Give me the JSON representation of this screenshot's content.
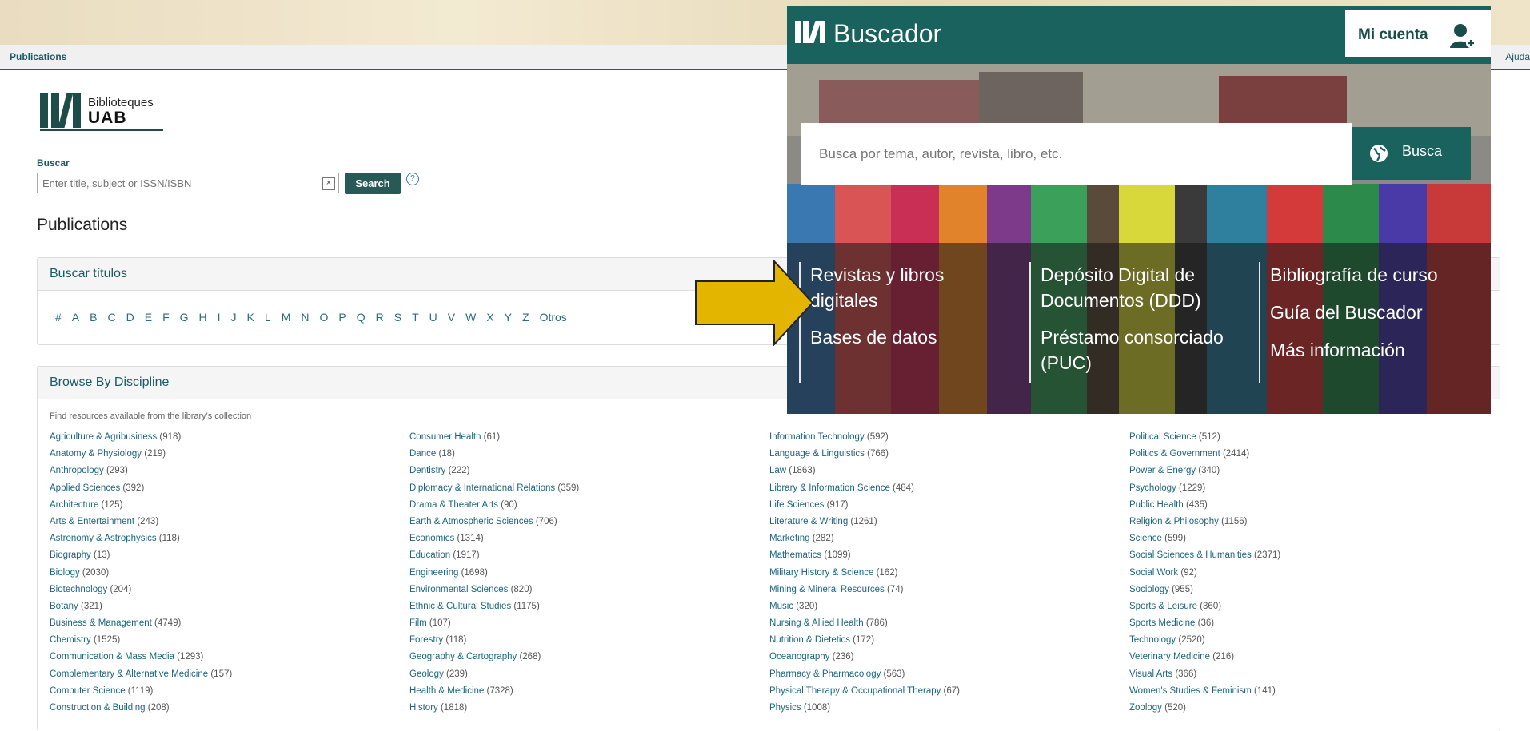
{
  "navbar": {
    "title": "Publications",
    "help": "Ajuda"
  },
  "logo": {
    "line1": "Biblioteques",
    "line2": "UAB"
  },
  "search": {
    "label": "Buscar",
    "placeholder": "Enter title, subject or ISSN/ISBN",
    "button": "Search",
    "help": "?"
  },
  "page_title": "Publications",
  "titles_panel": {
    "heading": "Buscar títulos",
    "letters": [
      "#",
      "A",
      "B",
      "C",
      "D",
      "E",
      "F",
      "G",
      "H",
      "I",
      "J",
      "K",
      "L",
      "M",
      "N",
      "O",
      "P",
      "Q",
      "R",
      "S",
      "T",
      "U",
      "V",
      "W",
      "X",
      "Y",
      "Z",
      "Otros"
    ]
  },
  "discipline_panel": {
    "heading": "Browse By Discipline",
    "intro": "Find resources available from the library's collection",
    "columns": [
      [
        {
          "name": "Agriculture & Agribusiness",
          "count": "(918)"
        },
        {
          "name": "Anatomy & Physiology",
          "count": "(219)"
        },
        {
          "name": "Anthropology",
          "count": "(293)"
        },
        {
          "name": "Applied Sciences",
          "count": "(392)"
        },
        {
          "name": "Architecture",
          "count": "(125)"
        },
        {
          "name": "Arts & Entertainment",
          "count": "(243)"
        },
        {
          "name": "Astronomy & Astrophysics",
          "count": "(118)"
        },
        {
          "name": "Biography",
          "count": "(13)"
        },
        {
          "name": "Biology",
          "count": "(2030)"
        },
        {
          "name": "Biotechnology",
          "count": "(204)"
        },
        {
          "name": "Botany",
          "count": "(321)"
        },
        {
          "name": "Business & Management",
          "count": "(4749)"
        },
        {
          "name": "Chemistry",
          "count": "(1525)"
        },
        {
          "name": "Communication & Mass Media",
          "count": "(1293)"
        },
        {
          "name": "Complementary & Alternative Medicine",
          "count": "(157)"
        },
        {
          "name": "Computer Science",
          "count": "(1119)"
        },
        {
          "name": "Construction & Building",
          "count": "(208)"
        }
      ],
      [
        {
          "name": "Consumer Health",
          "count": "(61)"
        },
        {
          "name": "Dance",
          "count": "(18)"
        },
        {
          "name": "Dentistry",
          "count": "(222)"
        },
        {
          "name": "Diplomacy & International Relations",
          "count": "(359)"
        },
        {
          "name": "Drama & Theater Arts",
          "count": "(90)"
        },
        {
          "name": "Earth & Atmospheric Sciences",
          "count": "(706)"
        },
        {
          "name": "Economics",
          "count": "(1314)"
        },
        {
          "name": "Education",
          "count": "(1917)"
        },
        {
          "name": "Engineering",
          "count": "(1698)"
        },
        {
          "name": "Environmental Sciences",
          "count": "(820)"
        },
        {
          "name": "Ethnic & Cultural Studies",
          "count": "(1175)"
        },
        {
          "name": "Film",
          "count": "(107)"
        },
        {
          "name": "Forestry",
          "count": "(118)"
        },
        {
          "name": "Geography & Cartography",
          "count": "(268)"
        },
        {
          "name": "Geology",
          "count": "(239)"
        },
        {
          "name": "Health & Medicine",
          "count": "(7328)"
        },
        {
          "name": "History",
          "count": "(1818)"
        }
      ],
      [
        {
          "name": "Information Technology",
          "count": "(592)"
        },
        {
          "name": "Language & Linguistics",
          "count": "(766)"
        },
        {
          "name": "Law",
          "count": "(1863)"
        },
        {
          "name": "Library & Information Science",
          "count": "(484)"
        },
        {
          "name": "Life Sciences",
          "count": "(917)"
        },
        {
          "name": "Literature & Writing",
          "count": "(1261)"
        },
        {
          "name": "Marketing",
          "count": "(282)"
        },
        {
          "name": "Mathematics",
          "count": "(1099)"
        },
        {
          "name": "Military History & Science",
          "count": "(162)"
        },
        {
          "name": "Mining & Mineral Resources",
          "count": "(74)"
        },
        {
          "name": "Music",
          "count": "(320)"
        },
        {
          "name": "Nursing & Allied Health",
          "count": "(786)"
        },
        {
          "name": "Nutrition & Dietetics",
          "count": "(172)"
        },
        {
          "name": "Oceanography",
          "count": "(236)"
        },
        {
          "name": "Pharmacy & Pharmacology",
          "count": "(563)"
        },
        {
          "name": "Physical Therapy & Occupational Therapy",
          "count": "(67)"
        },
        {
          "name": "Physics",
          "count": "(1008)"
        }
      ],
      [
        {
          "name": "Political Science",
          "count": "(512)"
        },
        {
          "name": "Politics & Government",
          "count": "(2414)"
        },
        {
          "name": "Power & Energy",
          "count": "(340)"
        },
        {
          "name": "Psychology",
          "count": "(1229)"
        },
        {
          "name": "Public Health",
          "count": "(435)"
        },
        {
          "name": "Religion & Philosophy",
          "count": "(1156)"
        },
        {
          "name": "Science",
          "count": "(599)"
        },
        {
          "name": "Social Sciences & Humanities",
          "count": "(2371)"
        },
        {
          "name": "Social Work",
          "count": "(92)"
        },
        {
          "name": "Sociology",
          "count": "(955)"
        },
        {
          "name": "Sports & Leisure",
          "count": "(360)"
        },
        {
          "name": "Sports Medicine",
          "count": "(36)"
        },
        {
          "name": "Technology",
          "count": "(2520)"
        },
        {
          "name": "Veterinary Medicine",
          "count": "(216)"
        },
        {
          "name": "Visual Arts",
          "count": "(366)"
        },
        {
          "name": "Women's Studies & Feminism",
          "count": "(141)"
        },
        {
          "name": "Zoology",
          "count": "(520)"
        }
      ]
    ]
  },
  "buscador": {
    "title": "Buscador",
    "account": "Mi cuenta",
    "search_placeholder": "Busca por tema, autor, revista, libro, etc.",
    "search_button": "Busca",
    "col1": [
      "Revistas y libros digitales",
      "Bases de datos"
    ],
    "col2": [
      "Depósito Digital de Documentos (DDD)",
      "Préstamo consorciado (PUC)"
    ],
    "col3": [
      "Bibliografía de curso",
      "Guía del Buscador",
      "Más información"
    ],
    "arrow_color": "#e3b400",
    "header_color": "#19625e"
  }
}
